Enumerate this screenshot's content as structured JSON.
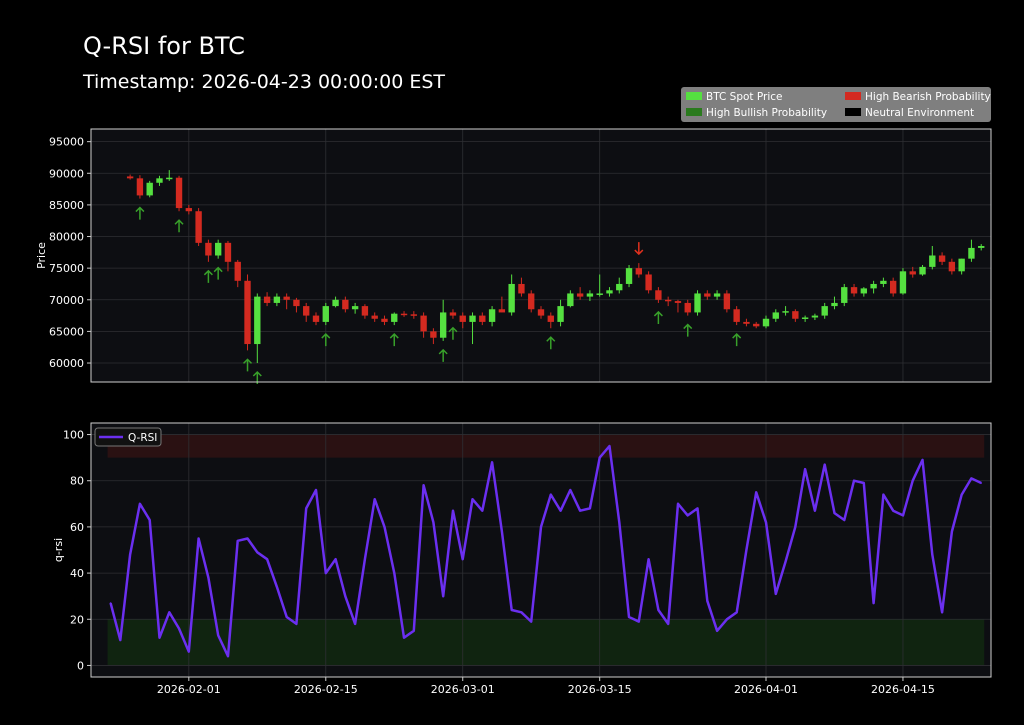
{
  "header": {
    "title": "Q-RSI for BTC",
    "subtitle": "Timestamp: 2026-04-23 00:00:00 EST"
  },
  "colors": {
    "background": "#000000",
    "axes_face": "#0d0e12",
    "bullish_candle": "#55e040",
    "bearish_candle": "#d42a20",
    "bull_arrow": "#38a02a",
    "bear_arrow": "#e0301e",
    "qrsi_line": "#6b2ff0",
    "overbought_band": "#2a1112",
    "oversold_band": "#102410"
  },
  "chart_data": [
    {
      "type": "candlestick",
      "ylabel": "Price",
      "ylim": [
        57000,
        97000
      ],
      "yticks": [
        60000,
        65000,
        70000,
        75000,
        80000,
        85000,
        90000,
        95000
      ],
      "xlim": [
        "2026-01-22",
        "2026-04-24"
      ],
      "grid": true,
      "legend_position": "top-right",
      "legend": [
        {
          "label": "BTC Spot Price",
          "color": "#55e040"
        },
        {
          "label": "High Bearish Probability",
          "color": "#d42a20"
        },
        {
          "label": "High Bullish Probability",
          "color": "#2a7a1e"
        },
        {
          "label": "Neutral Environment",
          "color": "#000000"
        }
      ],
      "ohlc": [
        [
          "2026-01-26",
          89500,
          89800,
          89000,
          89200
        ],
        [
          "2026-01-27",
          89200,
          89700,
          86000,
          86500
        ],
        [
          "2026-01-28",
          86500,
          88800,
          86200,
          88500
        ],
        [
          "2026-01-29",
          88500,
          89600,
          88000,
          89200
        ],
        [
          "2026-01-30",
          89200,
          90500,
          88800,
          89300
        ],
        [
          "2026-01-31",
          89300,
          89600,
          84000,
          84500
        ],
        [
          "2026-02-01",
          84500,
          85000,
          83500,
          84000
        ],
        [
          "2026-02-02",
          84000,
          84500,
          78500,
          79000
        ],
        [
          "2026-02-03",
          79000,
          79500,
          76000,
          77000
        ],
        [
          "2026-02-04",
          77000,
          79500,
          76500,
          79000
        ],
        [
          "2026-02-05",
          79000,
          79300,
          74500,
          76000
        ],
        [
          "2026-02-06",
          76000,
          76300,
          72000,
          73000
        ],
        [
          "2026-02-07",
          73000,
          74000,
          62000,
          63000
        ],
        [
          "2026-02-08",
          63000,
          71000,
          60000,
          70500
        ],
        [
          "2026-02-09",
          70500,
          71200,
          69000,
          69500
        ],
        [
          "2026-02-10",
          69500,
          71000,
          69000,
          70500
        ],
        [
          "2026-02-11",
          70500,
          71000,
          68500,
          70000
        ],
        [
          "2026-02-12",
          70000,
          70300,
          68000,
          69000
        ],
        [
          "2026-02-13",
          69000,
          69500,
          66500,
          67500
        ],
        [
          "2026-02-14",
          67500,
          68000,
          66000,
          66500
        ],
        [
          "2026-02-15",
          66500,
          69500,
          66000,
          69000
        ],
        [
          "2026-02-16",
          69000,
          70500,
          68800,
          70000
        ],
        [
          "2026-02-17",
          70000,
          70500,
          68000,
          68500
        ],
        [
          "2026-02-18",
          68500,
          69500,
          67800,
          69000
        ],
        [
          "2026-02-19",
          69000,
          69300,
          67000,
          67500
        ],
        [
          "2026-02-20",
          67500,
          68000,
          66500,
          67000
        ],
        [
          "2026-02-21",
          67000,
          67500,
          66000,
          66500
        ],
        [
          "2026-02-22",
          66500,
          68000,
          66000,
          67800
        ],
        [
          "2026-02-23",
          67800,
          68200,
          67300,
          67700
        ],
        [
          "2026-02-24",
          67700,
          68200,
          67000,
          67500
        ],
        [
          "2026-02-25",
          67500,
          68000,
          64000,
          65000
        ],
        [
          "2026-02-26",
          65000,
          65500,
          63000,
          64000
        ],
        [
          "2026-02-27",
          64000,
          70000,
          63500,
          68000
        ],
        [
          "2026-02-28",
          68000,
          68500,
          67000,
          67500
        ],
        [
          "2026-03-01",
          67500,
          68000,
          65500,
          66500
        ],
        [
          "2026-03-02",
          66500,
          68000,
          63000,
          67500
        ],
        [
          "2026-03-03",
          67500,
          68000,
          66000,
          66500
        ],
        [
          "2026-03-04",
          66500,
          69000,
          65800,
          68500
        ],
        [
          "2026-03-05",
          68500,
          70500,
          68000,
          68000
        ],
        [
          "2026-03-06",
          68000,
          74000,
          67500,
          72500
        ],
        [
          "2026-03-07",
          72500,
          73500,
          70500,
          71000
        ],
        [
          "2026-03-08",
          71000,
          71500,
          68000,
          68500
        ],
        [
          "2026-03-09",
          68500,
          69000,
          67000,
          67500
        ],
        [
          "2026-03-10",
          67500,
          68000,
          65500,
          66500
        ],
        [
          "2026-03-11",
          66500,
          70000,
          65800,
          69000
        ],
        [
          "2026-03-12",
          69000,
          71500,
          68800,
          71000
        ],
        [
          "2026-03-13",
          71000,
          72000,
          70000,
          70500
        ],
        [
          "2026-03-14",
          70500,
          71500,
          69800,
          71000
        ],
        [
          "2026-03-15",
          71000,
          74000,
          70500,
          71000
        ],
        [
          "2026-03-16",
          71000,
          72000,
          70500,
          71500
        ],
        [
          "2026-03-17",
          71500,
          73500,
          71000,
          72500
        ],
        [
          "2026-03-18",
          72500,
          75500,
          72000,
          75000
        ],
        [
          "2026-03-19",
          75000,
          75800,
          73500,
          74000
        ],
        [
          "2026-03-20",
          74000,
          74500,
          71000,
          71500
        ],
        [
          "2026-03-21",
          71500,
          72000,
          69500,
          70000
        ],
        [
          "2026-03-22",
          70000,
          70500,
          69000,
          69800
        ],
        [
          "2026-03-23",
          69800,
          70000,
          68000,
          69500
        ],
        [
          "2026-03-24",
          69500,
          70000,
          67500,
          68000
        ],
        [
          "2026-03-25",
          68000,
          71500,
          67500,
          71000
        ],
        [
          "2026-03-26",
          71000,
          71500,
          70000,
          70500
        ],
        [
          "2026-03-27",
          70500,
          71500,
          70000,
          71000
        ],
        [
          "2026-03-28",
          71000,
          71500,
          68000,
          68500
        ],
        [
          "2026-03-29",
          68500,
          69000,
          66000,
          66500
        ],
        [
          "2026-03-30",
          66500,
          67000,
          65800,
          66200
        ],
        [
          "2026-03-31",
          66200,
          66500,
          65500,
          65800
        ],
        [
          "2026-04-01",
          65800,
          67500,
          65500,
          67000
        ],
        [
          "2026-04-02",
          67000,
          68500,
          66500,
          68000
        ],
        [
          "2026-04-03",
          68000,
          69000,
          67500,
          68200
        ],
        [
          "2026-04-04",
          68200,
          68500,
          66500,
          67000
        ],
        [
          "2026-04-05",
          67000,
          67500,
          66500,
          67200
        ],
        [
          "2026-04-06",
          67200,
          67800,
          66800,
          67500
        ],
        [
          "2026-04-07",
          67500,
          69500,
          67000,
          69000
        ],
        [
          "2026-04-08",
          69000,
          70500,
          68500,
          69500
        ],
        [
          "2026-04-09",
          69500,
          72500,
          69000,
          72000
        ],
        [
          "2026-04-10",
          72000,
          72500,
          70500,
          71000
        ],
        [
          "2026-04-11",
          71000,
          72000,
          70500,
          71800
        ],
        [
          "2026-04-12",
          71800,
          73000,
          71000,
          72500
        ],
        [
          "2026-04-13",
          72500,
          73500,
          72000,
          73000
        ],
        [
          "2026-04-14",
          73000,
          73500,
          70500,
          71000
        ],
        [
          "2026-04-15",
          71000,
          75000,
          70800,
          74500
        ],
        [
          "2026-04-16",
          74500,
          75200,
          73500,
          74000
        ],
        [
          "2026-04-17",
          74000,
          75500,
          73800,
          75200
        ],
        [
          "2026-04-18",
          75200,
          78500,
          74800,
          77000
        ],
        [
          "2026-04-19",
          77000,
          77500,
          75500,
          76000
        ],
        [
          "2026-04-20",
          76000,
          76500,
          74000,
          74500
        ],
        [
          "2026-04-21",
          74500,
          76500,
          74000,
          76500
        ],
        [
          "2026-04-22",
          76500,
          79500,
          76000,
          78200
        ],
        [
          "2026-04-23",
          78200,
          78800,
          77800,
          78500
        ]
      ],
      "bullish_signals": [
        "2026-01-27",
        "2026-01-31",
        "2026-02-03",
        "2026-02-04",
        "2026-02-07",
        "2026-02-08",
        "2026-02-15",
        "2026-02-22",
        "2026-02-27",
        "2026-02-28",
        "2026-03-10",
        "2026-03-21",
        "2026-03-24",
        "2026-03-29"
      ],
      "bearish_signals": [
        "2026-03-19"
      ]
    },
    {
      "type": "line",
      "ylabel": "q-rsi",
      "ylim": [
        -5,
        105
      ],
      "yticks": [
        0,
        20,
        40,
        60,
        80,
        100
      ],
      "xlim": [
        "2026-01-22",
        "2026-04-24"
      ],
      "xticks": [
        "2026-02-01",
        "2026-02-15",
        "2026-03-01",
        "2026-03-15",
        "2026-04-01",
        "2026-04-15"
      ],
      "grid": true,
      "legend_position": "top-left",
      "bands": [
        {
          "name": "overbought",
          "from": 90,
          "to": 100
        },
        {
          "name": "oversold",
          "from": 0,
          "to": 20
        }
      ],
      "series": [
        {
          "name": "Q-RSI",
          "x": [
            "2026-01-24",
            "2026-01-25",
            "2026-01-26",
            "2026-01-27",
            "2026-01-28",
            "2026-01-29",
            "2026-01-30",
            "2026-01-31",
            "2026-02-01",
            "2026-02-02",
            "2026-02-03",
            "2026-02-04",
            "2026-02-05",
            "2026-02-06",
            "2026-02-07",
            "2026-02-08",
            "2026-02-09",
            "2026-02-10",
            "2026-02-11",
            "2026-02-12",
            "2026-02-13",
            "2026-02-14",
            "2026-02-15",
            "2026-02-16",
            "2026-02-17",
            "2026-02-18",
            "2026-02-19",
            "2026-02-20",
            "2026-02-21",
            "2026-02-22",
            "2026-02-23",
            "2026-02-24",
            "2026-02-25",
            "2026-02-26",
            "2026-02-27",
            "2026-02-28",
            "2026-03-01",
            "2026-03-02",
            "2026-03-03",
            "2026-03-04",
            "2026-03-05",
            "2026-03-06",
            "2026-03-07",
            "2026-03-08",
            "2026-03-09",
            "2026-03-10",
            "2026-03-11",
            "2026-03-12",
            "2026-03-13",
            "2026-03-14",
            "2026-03-15",
            "2026-03-16",
            "2026-03-17",
            "2026-03-18",
            "2026-03-19",
            "2026-03-20",
            "2026-03-21",
            "2026-03-22",
            "2026-03-23",
            "2026-03-24",
            "2026-03-25",
            "2026-03-26",
            "2026-03-27",
            "2026-03-28",
            "2026-03-29",
            "2026-03-30",
            "2026-03-31",
            "2026-04-01",
            "2026-04-02",
            "2026-04-03",
            "2026-04-04",
            "2026-04-05",
            "2026-04-06",
            "2026-04-07",
            "2026-04-08",
            "2026-04-09",
            "2026-04-10",
            "2026-04-11",
            "2026-04-12",
            "2026-04-13",
            "2026-04-14",
            "2026-04-15",
            "2026-04-16",
            "2026-04-17",
            "2026-04-18",
            "2026-04-19",
            "2026-04-20",
            "2026-04-21",
            "2026-04-22",
            "2026-04-23"
          ],
          "values": [
            27,
            11,
            48,
            70,
            63,
            12,
            23,
            16,
            6,
            55,
            38,
            13,
            4,
            54,
            55,
            49,
            46,
            34,
            21,
            18,
            68,
            76,
            40,
            46,
            30,
            18,
            46,
            72,
            60,
            40,
            12,
            15,
            78,
            62,
            30,
            67,
            46,
            72,
            67,
            88,
            58,
            24,
            23,
            19,
            60,
            74,
            67,
            76,
            67,
            68,
            90,
            95,
            62,
            21,
            19,
            46,
            24,
            18,
            70,
            65,
            68,
            28,
            15,
            20,
            23,
            50,
            75,
            62,
            31,
            45,
            60,
            85,
            67,
            87,
            66,
            63,
            80,
            79,
            27,
            74,
            67,
            65,
            80,
            89,
            48,
            23,
            58,
            74,
            81,
            79
          ]
        }
      ]
    }
  ]
}
